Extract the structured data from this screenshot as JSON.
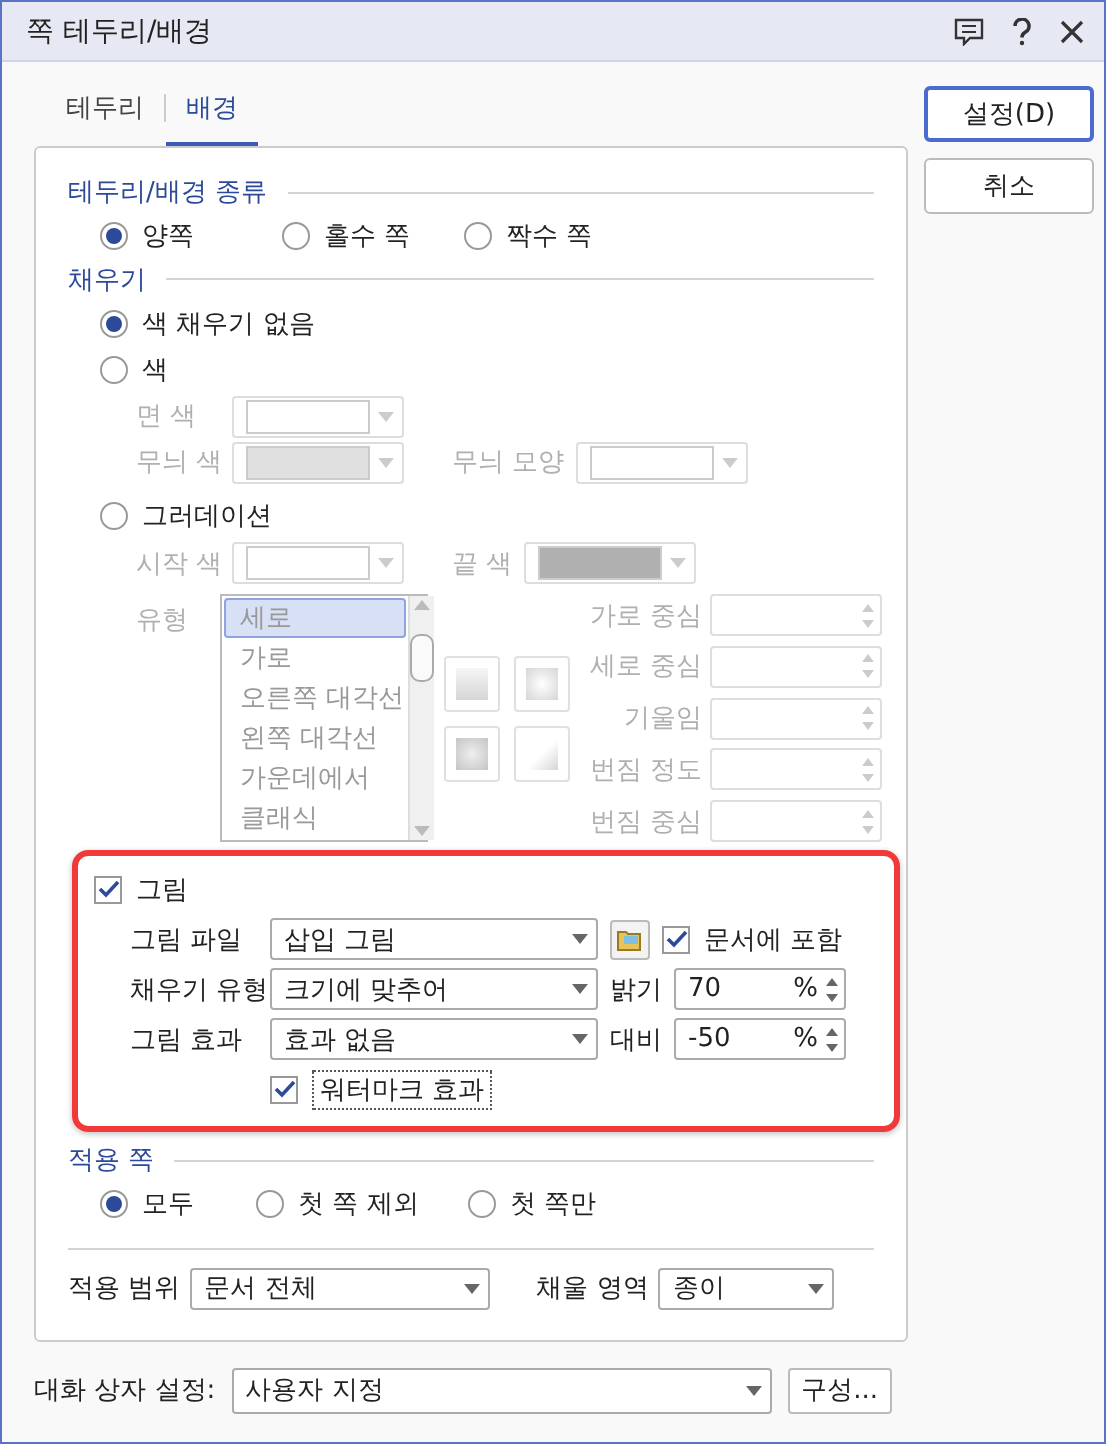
{
  "window": {
    "title": "쪽 테두리/배경"
  },
  "tabs": [
    {
      "label": "테두리",
      "selected": false
    },
    {
      "label": "배경",
      "selected": true
    }
  ],
  "buttons": [
    {
      "label": "설정(D)",
      "default": true
    },
    {
      "label": "취소",
      "default": false
    }
  ],
  "kind_group": {
    "title": "테두리/배경 종류",
    "options": [
      {
        "label": "양쪽",
        "selected": true
      },
      {
        "label": "홀수 쪽",
        "selected": false
      },
      {
        "label": "짝수 쪽",
        "selected": false
      }
    ]
  },
  "fill": {
    "title": "채우기",
    "none": {
      "label": "색 채우기 없음",
      "selected": true
    },
    "color": {
      "label": "색",
      "selected": false,
      "face_label": "면 색",
      "pattern_color_label": "무늬 색",
      "pattern_shape_label": "무늬 모양"
    },
    "gradient": {
      "label": "그러데이션",
      "selected": false,
      "start_label": "시작 색",
      "end_label": "끝 색",
      "type_label": "유형",
      "types": [
        {
          "label": "세로",
          "selected": true
        },
        {
          "label": "가로",
          "selected": false
        },
        {
          "label": "오른쪽 대각선",
          "selected": false
        },
        {
          "label": "왼쪽 대각선",
          "selected": false
        },
        {
          "label": "가운데에서",
          "selected": false
        },
        {
          "label": "클래식",
          "selected": false
        }
      ],
      "fields": [
        "가로 중심",
        "세로 중심",
        "기울임",
        "번짐 정도",
        "번짐 중심"
      ]
    }
  },
  "picture": {
    "label": "그림",
    "checked": true,
    "highlighted": true,
    "file_label": "그림 파일",
    "file_value": "삽입 그림",
    "embed": {
      "label": "문서에 포함",
      "checked": true
    },
    "fill_type_label": "채우기 유형",
    "fill_type_value": "크기에 맞추어",
    "brightness": {
      "label": "밝기",
      "value": "70",
      "unit": "%"
    },
    "effect_label": "그림 효과",
    "effect_value": "효과 없음",
    "contrast": {
      "label": "대비",
      "value": "-50",
      "unit": "%"
    },
    "watermark": {
      "label": "워터마크 효과",
      "checked": true
    }
  },
  "apply_pages": {
    "title": "적용 쪽",
    "options": [
      {
        "label": "모두",
        "selected": true
      },
      {
        "label": "첫 쪽 제외",
        "selected": false
      },
      {
        "label": "첫 쪽만",
        "selected": false
      }
    ]
  },
  "scope": {
    "label": "적용 범위",
    "value": "문서 전체"
  },
  "fill_area": {
    "label": "채울 영역",
    "value": "종이"
  },
  "dialog_settings": {
    "label": "대화 상자 설정:",
    "value": "사용자 지정"
  },
  "configure_button": "구성..."
}
